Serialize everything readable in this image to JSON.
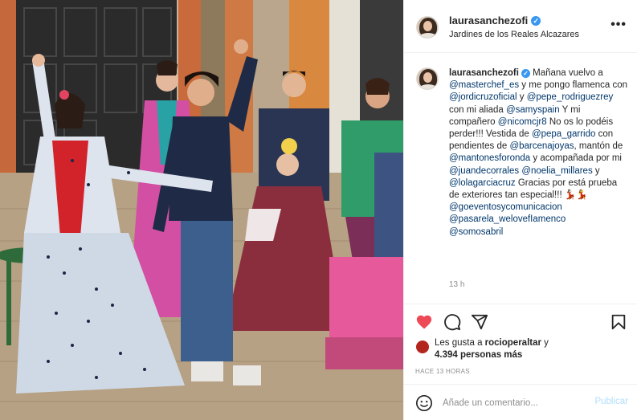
{
  "post": {
    "username": "laurasanchezofi",
    "verified": true,
    "location": "Jardines de los Reales Alcazares",
    "more_glyph": "•••",
    "caption": {
      "p1": "Mañana vuelvo a ",
      "m1": "@masterchef_es",
      "p2": " y me pongo flamenca con ",
      "m2": "@jordicruzoficial",
      "p3": " y ",
      "m3": "@pepe_rodriguezrey",
      "p4": " con mi aliada ",
      "m4": "@samyspain",
      "p5": " Y mi compañero ",
      "m5": "@nicomcjr8",
      "p6": " No os lo podéis perder!!! Vestida de ",
      "m6": "@pepa_garrido",
      "p7": " con pendientes de ",
      "m7": "@barcenajoyas",
      "p8": ", mantón de ",
      "m8": "@mantonesforonda",
      "p9": " y acompañada por mi ",
      "m9": "@juandecorrales",
      "p10": " ",
      "m10": "@noelia_millares",
      "p11": " y ",
      "m11": "@lolagarciacruz",
      "p12": " Gracias por está prueba de exteriores tan especial!!! 💃🏻💃",
      "m12": "@goeventosycomunicacion",
      "m13": "@pasarela_welovefIamenco",
      "m14": "@somosabril"
    },
    "time_ago": "13 h",
    "likes": {
      "prefix": "Les gusta a ",
      "user": "rocioperaltar",
      "suffix": " y",
      "count_text": "4.394 personas más"
    },
    "timestamp": "HACE 13 HORAS",
    "comment": {
      "placeholder": "Añade un comentario...",
      "publish_label": "Publicar"
    }
  },
  "colors": {
    "like_red": "#ed4956",
    "mention_blue": "#00376b",
    "publish_disabled": "#b2dffc",
    "verified_blue": "#3897f0"
  },
  "icons": [
    "heart-icon",
    "comment-icon",
    "share-icon",
    "save-icon",
    "emoji-icon",
    "verified-icon",
    "more-icon"
  ]
}
